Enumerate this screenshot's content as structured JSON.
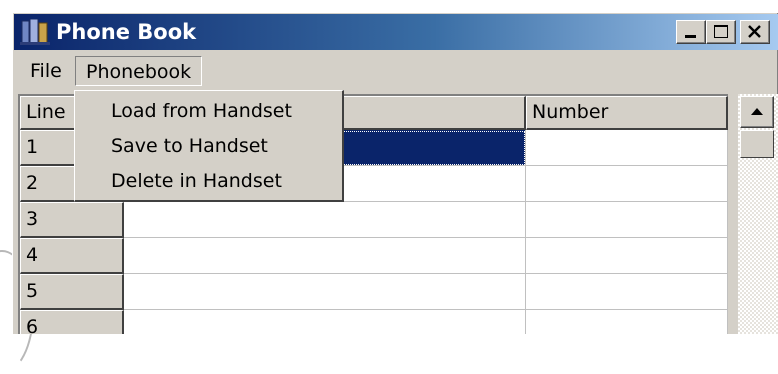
{
  "window": {
    "title": "Phone Book",
    "icon": "phone-book-app-icon"
  },
  "titlebar_buttons": [
    {
      "name": "minimize",
      "icon": "minimize-icon"
    },
    {
      "name": "maximize",
      "icon": "maximize-icon"
    },
    {
      "name": "close",
      "icon": "close-icon"
    }
  ],
  "menubar": {
    "file": "File",
    "phonebook": "Phonebook"
  },
  "phonebook_menu": {
    "items": [
      "Load from Handset",
      "Save to Handset",
      "Delete in Handset"
    ]
  },
  "grid": {
    "columns": {
      "line": "Line",
      "name": "",
      "number": "Number"
    },
    "rows": [
      {
        "line": "1",
        "name": "",
        "number": "",
        "selected_cell": "name"
      },
      {
        "line": "2",
        "name": "",
        "number": ""
      },
      {
        "line": "3",
        "name": "",
        "number": ""
      },
      {
        "line": "4",
        "name": "",
        "number": ""
      },
      {
        "line": "5",
        "name": "",
        "number": ""
      },
      {
        "line": "6",
        "name": "",
        "number": ""
      }
    ]
  },
  "scrollbar": {
    "up_icon": "scroll-up-arrow-icon"
  },
  "colors": {
    "title_start": "#0a246a",
    "title_end": "#a6caf0",
    "face": "#d4d0c8",
    "selection": "#0a246a"
  }
}
